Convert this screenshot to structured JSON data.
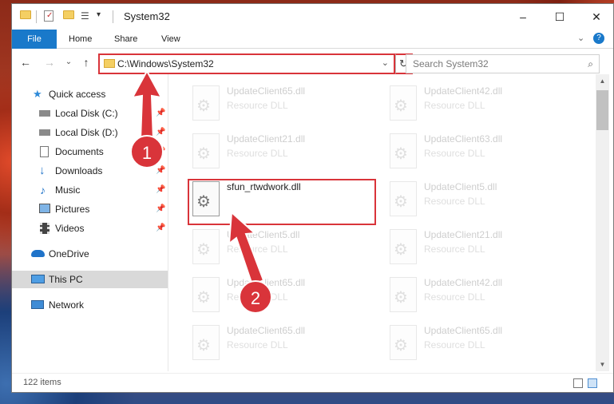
{
  "window": {
    "title": "System32",
    "minimize": "–",
    "maximize": "☐",
    "close": "✕"
  },
  "ribbon": {
    "tabs": [
      "File",
      "Home",
      "Share",
      "View"
    ],
    "collapse": "⌄",
    "help": "?"
  },
  "address": {
    "path": "C:\\Windows\\System32",
    "dropdown": "⌄",
    "refresh": "↻"
  },
  "nav": {
    "back": "←",
    "forward": "→",
    "recent": "⌄",
    "up": "↑"
  },
  "search": {
    "placeholder": "Search System32"
  },
  "sidebar": {
    "items": [
      {
        "label": "Quick access",
        "icon": "star-icon",
        "pinned": false
      },
      {
        "label": "Local Disk (C:)",
        "icon": "drive-icon",
        "pinned": true
      },
      {
        "label": "Local Disk (D:)",
        "icon": "drive-icon",
        "pinned": true
      },
      {
        "label": "Documents",
        "icon": "document-icon",
        "pinned": true
      },
      {
        "label": "Downloads",
        "icon": "download-icon",
        "pinned": true
      },
      {
        "label": "Music",
        "icon": "music-icon",
        "pinned": true
      },
      {
        "label": "Pictures",
        "icon": "pictures-icon",
        "pinned": true
      },
      {
        "label": "Videos",
        "icon": "videos-icon",
        "pinned": true
      },
      {
        "label": "OneDrive",
        "icon": "cloud-icon",
        "pinned": false
      },
      {
        "label": "This PC",
        "icon": "computer-icon",
        "pinned": false,
        "selected": true
      },
      {
        "label": "Network",
        "icon": "network-icon",
        "pinned": false
      }
    ]
  },
  "files": [
    {
      "name": "UpdateClient65.dll",
      "type": "Resource DLL"
    },
    {
      "name": "UpdateClient42.dll",
      "type": "Resource DLL"
    },
    {
      "name": "UpdateClient21.dll",
      "type": "Resource DLL"
    },
    {
      "name": "UpdateClient63.dll",
      "type": "Resource DLL"
    },
    {
      "name": "sfun_rtwdwork.dll",
      "type": "",
      "highlighted": true
    },
    {
      "name": "UpdateClient5.dll",
      "type": "Resource DLL"
    },
    {
      "name": "UpdateClient5.dll",
      "type": "Resource DLL"
    },
    {
      "name": "UpdateClient21.dll",
      "type": "Resource DLL"
    },
    {
      "name": "UpdateClient65.dll",
      "type": "Resource DLL"
    },
    {
      "name": "UpdateClient42.dll",
      "type": "Resource DLL"
    },
    {
      "name": "UpdateClient65.dll",
      "type": "Resource DLL"
    },
    {
      "name": "UpdateClient65.dll",
      "type": "Resource DLL"
    }
  ],
  "status": {
    "item_count": "122 items"
  },
  "annotations": {
    "step1": "1",
    "step2": "2",
    "color": "#d9343a"
  }
}
